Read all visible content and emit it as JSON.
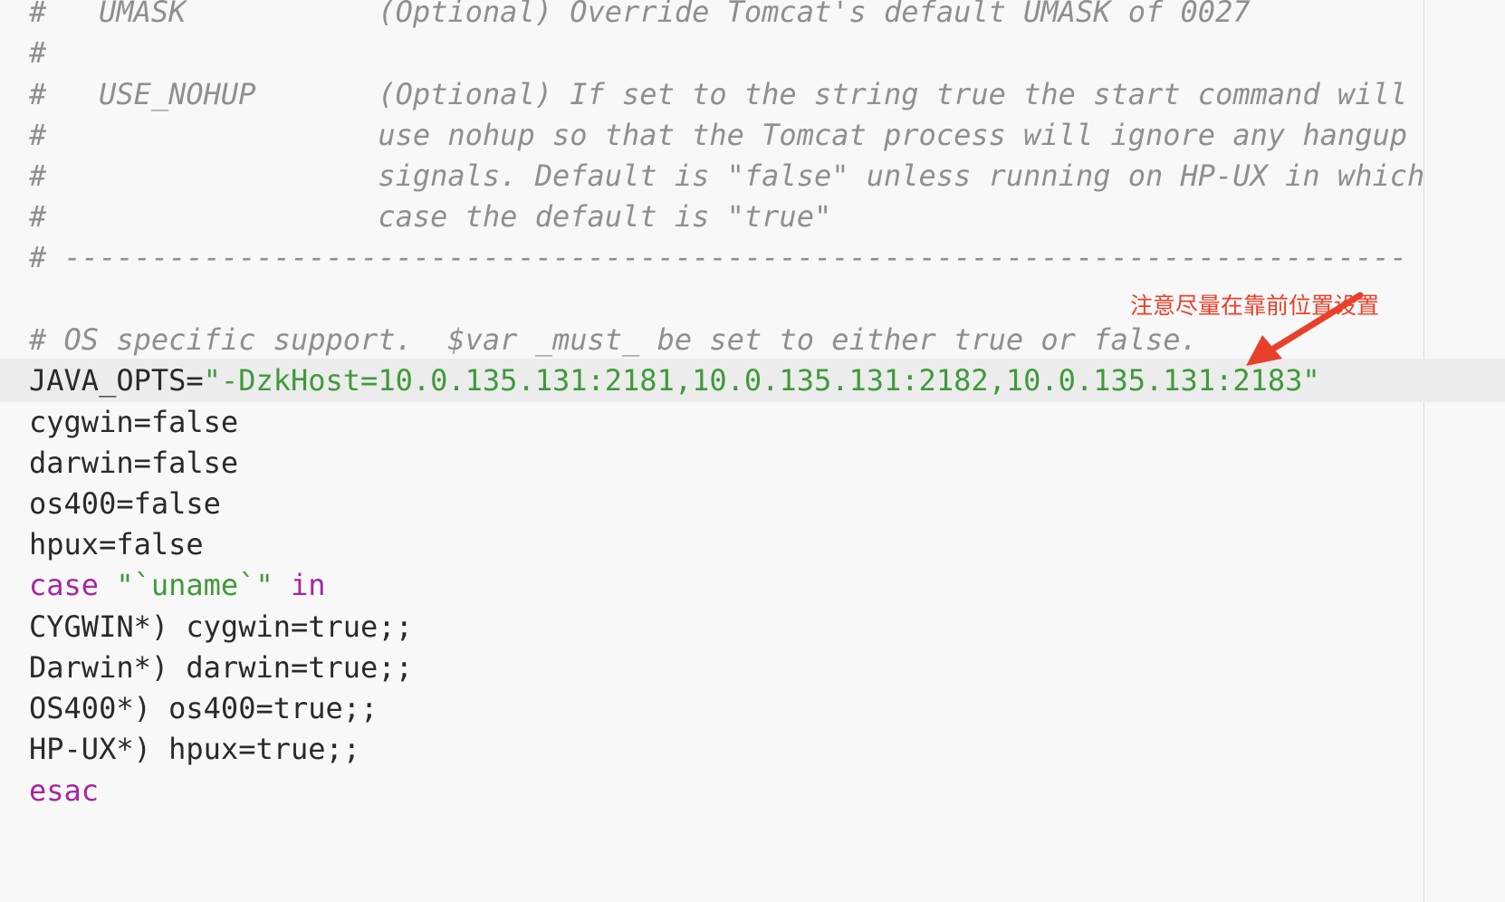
{
  "lines": [
    {
      "type": "comment",
      "text": "#   UMASK           (Optional) Override Tomcat's default UMASK of 0027"
    },
    {
      "type": "comment",
      "text": "#"
    },
    {
      "type": "comment",
      "text": "#   USE_NOHUP       (Optional) If set to the string true the start command will"
    },
    {
      "type": "comment",
      "text": "#                   use nohup so that the Tomcat process will ignore any hangup"
    },
    {
      "type": "comment",
      "text": "#                   signals. Default is \"false\" unless running on HP-UX in which"
    },
    {
      "type": "comment",
      "text": "#                   case the default is \"true\""
    },
    {
      "type": "comment",
      "text": "# -----------------------------------------------------------------------------"
    },
    {
      "type": "blank",
      "text": ""
    },
    {
      "type": "comment",
      "text": "# OS specific support.  $var _must_ be set to either true or false."
    },
    {
      "type": "assign",
      "name": "JAVA_OPTS=",
      "value": "\"-DzkHost=10.0.135.131:2181,10.0.135.131:2182,10.0.135.131:2183\""
    },
    {
      "type": "plain",
      "text": "cygwin=false"
    },
    {
      "type": "plain",
      "text": "darwin=false"
    },
    {
      "type": "plain",
      "text": "os400=false"
    },
    {
      "type": "plain",
      "text": "hpux=false"
    },
    {
      "type": "case",
      "kw1": "case",
      "value": "\"`uname`\"",
      "kw2": "in"
    },
    {
      "type": "plain",
      "text": "CYGWIN*) cygwin=true;;"
    },
    {
      "type": "plain",
      "text": "Darwin*) darwin=true;;"
    },
    {
      "type": "plain",
      "text": "OS400*) os400=true;;"
    },
    {
      "type": "plain",
      "text": "HP-UX*) hpux=true;;"
    },
    {
      "type": "keyword",
      "text": "esac"
    }
  ],
  "annotation": {
    "text": "注意尽量在靠前位置设置",
    "color": "#e8412b"
  },
  "colors": {
    "background": "#f8f8f8",
    "comment": "#8f8f8f",
    "string": "#3f9a3a",
    "keyword": "#a626a4",
    "text": "#2a2a2a",
    "current_line": "#ececec"
  }
}
